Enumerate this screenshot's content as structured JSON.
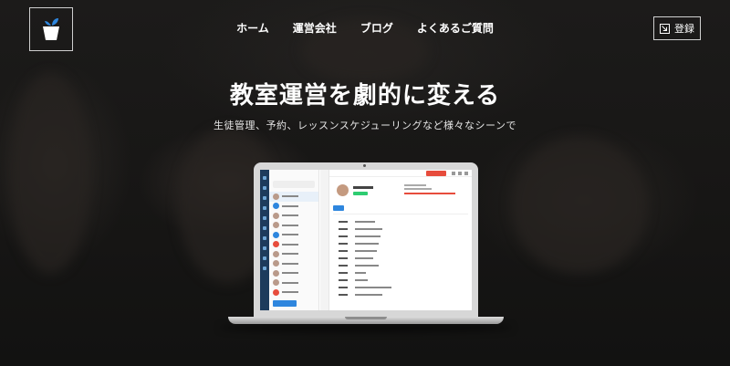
{
  "nav": {
    "items": [
      "ホーム",
      "運営会社",
      "ブログ",
      "よくあるご質問"
    ],
    "register_label": "登録"
  },
  "hero": {
    "headline": "教室運営を劇的に変える",
    "subline": "生徒管理、予約、レッスンスケジューリングなど様々なシーンで"
  },
  "colors": {
    "background": "#141414",
    "text": "#ffffff",
    "app_accent": "#2e86de",
    "app_sidebar": "#1d3b5c",
    "logo_leaf": "#2e86de"
  },
  "icons": {
    "logo": "plant-pot-icon",
    "register": "register-arrow-icon"
  }
}
